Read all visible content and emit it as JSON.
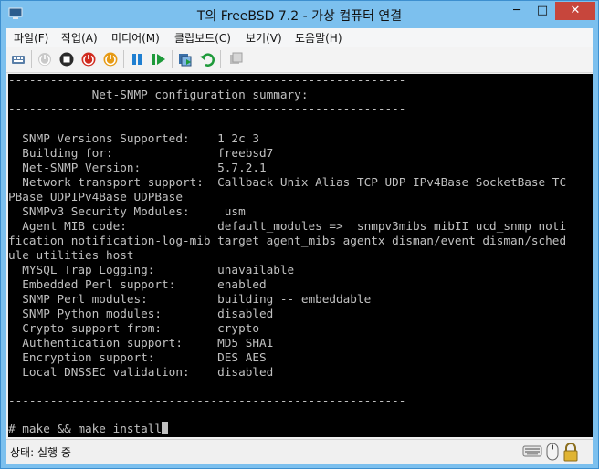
{
  "window": {
    "title": "T의 FreeBSD 7.2 - 가상 컴퓨터 연결",
    "controls": {
      "minimize": "─",
      "maximize": "□",
      "close": "✕"
    }
  },
  "menu": [
    "파일(F)",
    "작업(A)",
    "미디어(M)",
    "클립보드(C)",
    "보기(V)",
    "도움말(H)"
  ],
  "toolbar_icons": [
    "ctrl-alt-del-icon",
    "start-icon",
    "turn-off-icon",
    "shut-down-icon",
    "save-icon",
    "pause-icon",
    "resume-icon",
    "snapshot-icon",
    "revert-icon",
    "settings-icon"
  ],
  "terminal": {
    "lines": [
      "---------------------------------------------------------",
      "            Net-SNMP configuration summary:",
      "---------------------------------------------------------",
      "",
      "  SNMP Versions Supported:    1 2c 3",
      "  Building for:               freebsd7",
      "  Net-SNMP Version:           5.7.2.1",
      "  Network transport support:  Callback Unix Alias TCP UDP IPv4Base SocketBase TC",
      "PBase UDPIPv4Base UDPBase",
      "  SNMPv3 Security Modules:     usm",
      "  Agent MIB code:             default_modules =>  snmpv3mibs mibII ucd_snmp noti",
      "fication notification-log-mib target agent_mibs agentx disman/event disman/sched",
      "ule utilities host",
      "  MYSQL Trap Logging:         unavailable",
      "  Embedded Perl support:      enabled",
      "  SNMP Perl modules:          building -- embeddable",
      "  SNMP Python modules:        disabled",
      "  Crypto support from:        crypto",
      "  Authentication support:     MD5 SHA1",
      "  Encryption support:         DES AES",
      "  Local DNSSEC validation:    disabled",
      "",
      "---------------------------------------------------------",
      "",
      "# make && make install"
    ]
  },
  "status": {
    "text": "상태: 실행 중",
    "icons": [
      "keyboard-icon",
      "mouse-icon",
      "lock-icon"
    ]
  },
  "colors": {
    "title_bar": "#7cc0ee",
    "terminal_bg": "#000000",
    "terminal_fg": "#c0c0c0",
    "close_button": "#c7463c"
  }
}
